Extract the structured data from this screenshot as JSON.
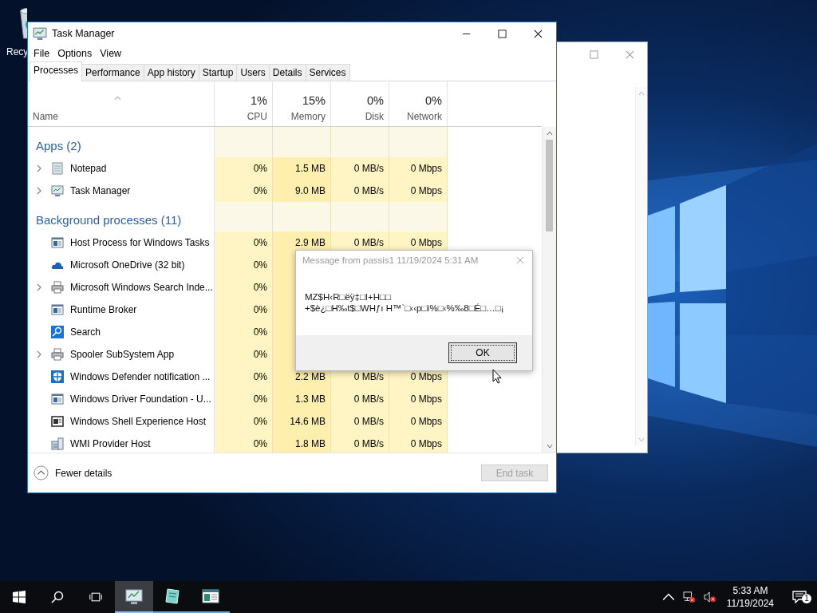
{
  "desktop": {
    "icon_label": "Recy"
  },
  "task_manager": {
    "title": "Task Manager",
    "menu": [
      "File",
      "Options",
      "View"
    ],
    "tabs": [
      {
        "label": "Processes",
        "selected": true
      },
      {
        "label": "Performance",
        "selected": false
      },
      {
        "label": "App history",
        "selected": false
      },
      {
        "label": "Startup",
        "selected": false
      },
      {
        "label": "Users",
        "selected": false
      },
      {
        "label": "Details",
        "selected": false
      },
      {
        "label": "Services",
        "selected": false
      }
    ],
    "columns": [
      {
        "label": "Name"
      },
      {
        "percent": "1%",
        "label": "CPU"
      },
      {
        "percent": "15%",
        "label": "Memory"
      },
      {
        "percent": "0%",
        "label": "Disk"
      },
      {
        "percent": "0%",
        "label": "Network"
      }
    ],
    "groups": [
      {
        "title": "Apps (2)",
        "rows": [
          {
            "name": "Notepad",
            "expandable": true,
            "cpu": "0%",
            "memory": "1.5 MB",
            "disk": "0 MB/s",
            "network": "0 Mbps"
          },
          {
            "name": "Task Manager",
            "expandable": true,
            "cpu": "0%",
            "memory": "9.0 MB",
            "disk": "0 MB/s",
            "network": "0 Mbps"
          }
        ]
      },
      {
        "title": "Background processes (11)",
        "rows": [
          {
            "name": "Host Process for Windows Tasks",
            "expandable": false,
            "cpu": "0%",
            "memory": "2.9 MB",
            "disk": "0 MB/s",
            "network": "0 Mbps"
          },
          {
            "name": "Microsoft OneDrive (32 bit)",
            "expandable": false,
            "cpu": "0%"
          },
          {
            "name": "Microsoft Windows Search Inde...",
            "expandable": true,
            "cpu": "0%"
          },
          {
            "name": "Runtime Broker",
            "expandable": false,
            "cpu": "0%"
          },
          {
            "name": "Search",
            "expandable": false,
            "cpu": "0%"
          },
          {
            "name": "Spooler SubSystem App",
            "expandable": true,
            "cpu": "0%"
          },
          {
            "name": "Windows Defender notification ...",
            "expandable": false,
            "cpu": "0%",
            "memory": "2.2 MB",
            "disk": "0 MB/s",
            "network": "0 Mbps"
          },
          {
            "name": "Windows Driver Foundation - U...",
            "expandable": false,
            "cpu": "0%",
            "memory": "1.3 MB",
            "disk": "0 MB/s",
            "network": "0 Mbps"
          },
          {
            "name": "Windows Shell Experience Host",
            "expandable": false,
            "cpu": "0%",
            "memory": "14.6 MB",
            "disk": "0 MB/s",
            "network": "0 Mbps"
          },
          {
            "name": "WMI Provider Host",
            "expandable": false,
            "cpu": "0%",
            "memory": "1.8 MB",
            "disk": "0 MB/s",
            "network": "0 Mbps"
          }
        ]
      }
    ],
    "fewer_details": "Fewer details",
    "end_task": {
      "label": "End task",
      "disabled": true
    }
  },
  "message_box": {
    "title": "Message from passis1 11/19/2024 5:31 AM",
    "message": [
      "MZ$H‹R□ëÿ‡□I+H□□",
      "+$è¿□H‰t$□WHƒı H™`□‹‹p□ì%□‹%‰8□É□…□¡"
    ],
    "ok": "OK"
  },
  "taskbar": {
    "apps": [
      {
        "selected": true
      },
      {
        "selected": false
      },
      {
        "selected": false
      }
    ],
    "time": "5:33 AM",
    "date": "11/19/2024",
    "notifications": "1"
  }
}
